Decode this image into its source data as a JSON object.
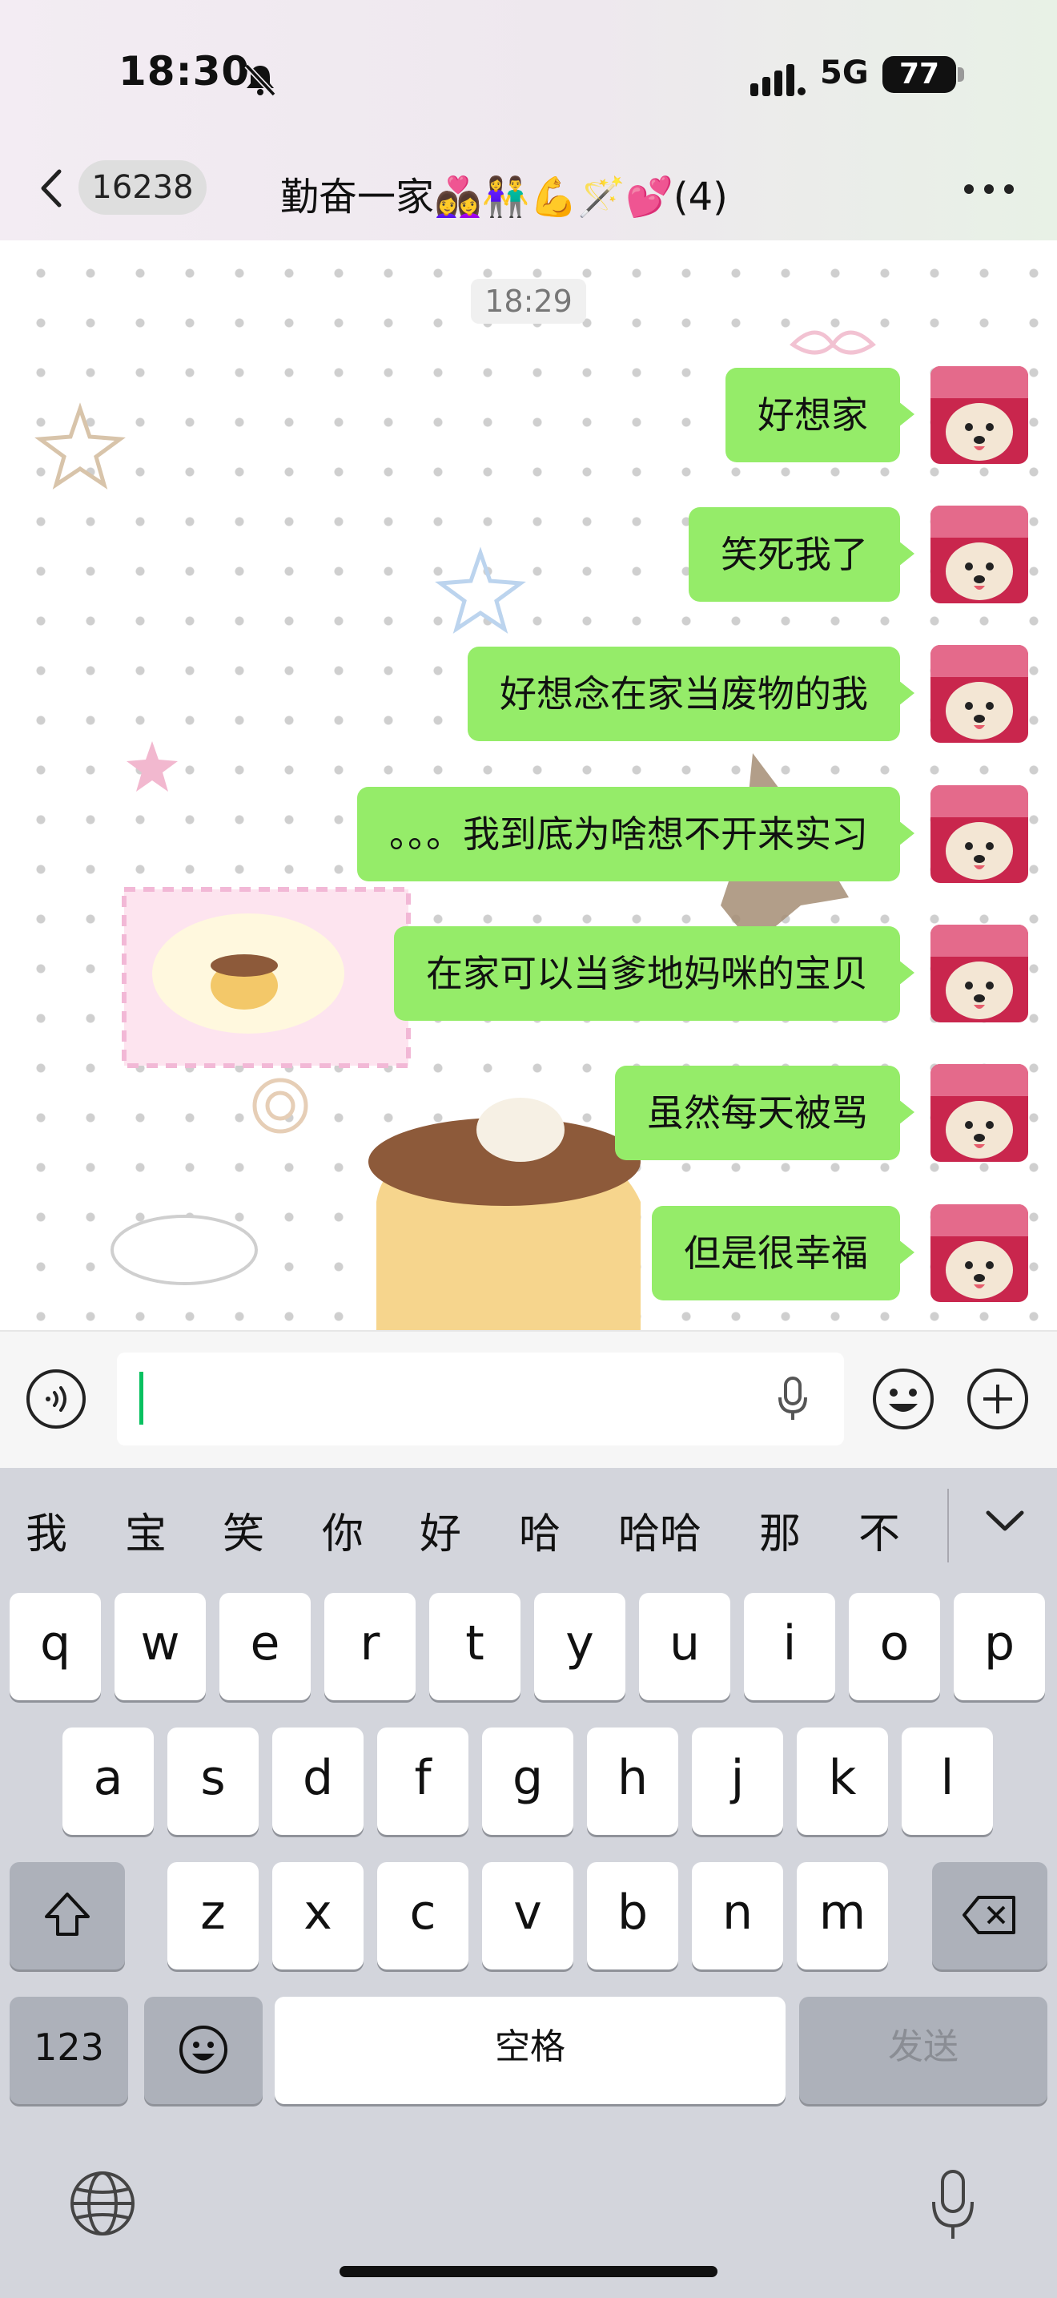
{
  "status_bar": {
    "time": "18:30",
    "network": "5G",
    "battery": "77"
  },
  "header": {
    "unread_count": "16238",
    "title": "勤奋一家👩‍❤️‍👩👫💪🪄💕",
    "member_count": "(4)"
  },
  "chat": {
    "timestamp": "18:29",
    "messages": [
      {
        "text": "好想家"
      },
      {
        "text": "笑死我了"
      },
      {
        "text": "好想念在家当废物的我"
      },
      {
        "text": "。。。我到底为啥想不开来实习"
      },
      {
        "text": "在家可以当爹地妈咪的宝贝"
      },
      {
        "text": "虽然每天被骂"
      },
      {
        "text": "但是很幸福"
      }
    ]
  },
  "keyboard": {
    "suggestions": [
      "我",
      "宝",
      "笑",
      "你",
      "好",
      "哈",
      "哈哈",
      "那",
      "不"
    ],
    "row1": [
      "q",
      "w",
      "e",
      "r",
      "t",
      "y",
      "u",
      "i",
      "o",
      "p"
    ],
    "row2": [
      "a",
      "s",
      "d",
      "f",
      "g",
      "h",
      "j",
      "k",
      "l"
    ],
    "row3": [
      "z",
      "x",
      "c",
      "v",
      "b",
      "n",
      "m"
    ],
    "numbers_label": "123",
    "space_label": "空格",
    "send_label": "发送"
  },
  "colors": {
    "bubble": "#95ec69",
    "cursor": "#07c160",
    "keyboard_bg": "#d3d5dc"
  },
  "icons": [
    "bell-slash-icon",
    "signal-icon",
    "chevron-left-icon",
    "more-icon",
    "voice-icon",
    "mic-icon",
    "emoji-icon",
    "plus-icon",
    "chevron-down-icon",
    "shift-icon",
    "backspace-icon",
    "globe-icon"
  ]
}
